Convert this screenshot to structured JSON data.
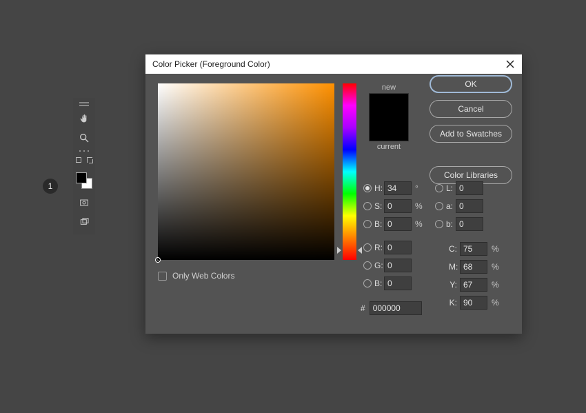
{
  "step_marker": "1",
  "toolbar": {
    "icons": [
      "hand-icon",
      "zoom-icon",
      "more-icon",
      "arrange-icon",
      "fgbg-icon",
      "view-icon",
      "overlap-icon"
    ]
  },
  "dialog": {
    "title": "Color Picker (Foreground Color)",
    "buttons": {
      "ok": "OK",
      "cancel": "Cancel",
      "add_swatches": "Add to Swatches",
      "color_libraries": "Color Libraries"
    },
    "swatch": {
      "new_label": "new",
      "current_label": "current",
      "new_color": "#000000",
      "current_color": "#000000"
    },
    "only_web_colors": "Only Web Colors",
    "hue_selected": 34,
    "fields": {
      "H": {
        "label": "H:",
        "value": "34",
        "unit": "°",
        "radio": true,
        "selected": true
      },
      "S": {
        "label": "S:",
        "value": "0",
        "unit": "%",
        "radio": true
      },
      "Bri": {
        "label": "B:",
        "value": "0",
        "unit": "%",
        "radio": true
      },
      "R": {
        "label": "R:",
        "value": "0",
        "unit": "",
        "radio": true
      },
      "G": {
        "label": "G:",
        "value": "0",
        "unit": "",
        "radio": true
      },
      "Bch": {
        "label": "B:",
        "value": "0",
        "unit": "",
        "radio": true
      },
      "L": {
        "label": "L:",
        "value": "0",
        "unit": "",
        "radio": true
      },
      "a": {
        "label": "a:",
        "value": "0",
        "unit": "",
        "radio": true
      },
      "b": {
        "label": "b:",
        "value": "0",
        "unit": "",
        "radio": true
      },
      "C": {
        "label": "C:",
        "value": "75",
        "unit": "%"
      },
      "M": {
        "label": "M:",
        "value": "68",
        "unit": "%"
      },
      "Y": {
        "label": "Y:",
        "value": "67",
        "unit": "%"
      },
      "K": {
        "label": "K:",
        "value": "90",
        "unit": "%"
      }
    },
    "hex": {
      "hash": "#",
      "value": "000000"
    }
  }
}
